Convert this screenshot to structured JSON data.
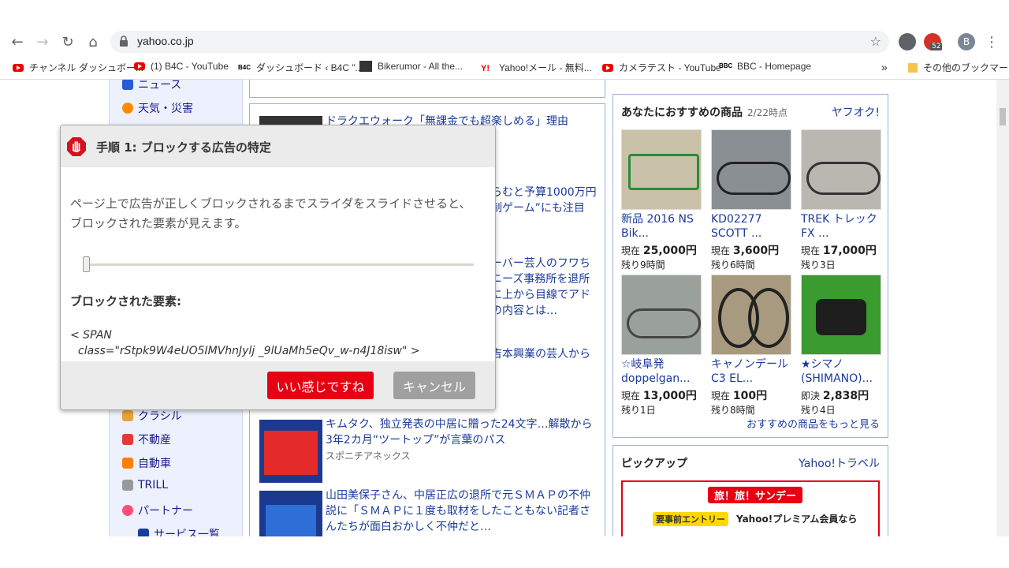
{
  "browser": {
    "url": "yahoo.co.jp",
    "extension_badge": "52",
    "profile_initial": "B",
    "bookmarks": [
      {
        "label": "チャンネル ダッシュボー...",
        "icon": "youtube-icon"
      },
      {
        "label": "(1) B4C - YouTube",
        "icon": "youtube-icon"
      },
      {
        "label": "ダッシュボード ‹ B4C ”...",
        "icon": "b4c-icon"
      },
      {
        "label": "Bikerumor - All the...",
        "icon": "bike-icon"
      },
      {
        "label": "Yahoo!メール - 無料...",
        "icon": "yahoo-icon"
      },
      {
        "label": "カメラテスト - YouTube",
        "icon": "youtube-icon"
      },
      {
        "label": "BBC - Homepage",
        "icon": "bbc-icon"
      }
    ],
    "bookmarks_more": "»",
    "other_bookmarks": "その他のブックマーク"
  },
  "left_nav": {
    "items": [
      {
        "label": "ニュース",
        "color": "#2a5bd7"
      },
      {
        "label": "天気・災害",
        "color": "#ff8a00"
      },
      {
        "label": "クラシル",
        "color": "#e8a23a"
      },
      {
        "label": "不動産",
        "color": "#e53935"
      },
      {
        "label": "自動車",
        "color": "#ff7f00"
      },
      {
        "label": "TRILL",
        "color": "#999999"
      },
      {
        "label": "パートナー",
        "color": "#ff4d7a"
      },
      {
        "label": "サービス一覧",
        "color": "#1a3a9c"
      }
    ]
  },
  "news": {
    "items": [
      {
        "title": "ドラクエウォーク「無課金でも超楽しめる」理由",
        "source": ""
      },
      {
        "title": "キムタク、独立発表の中居に贈った24文字…解散から3年2カ月“ツートップ”が言葉のパス",
        "source": "スポニチアネックス"
      },
      {
        "title": "山田美保子さん、中居正広の退所で元ＳＭＡＰの不仲説に「ＳＭＡＰに１度も取材をしたこともない記者さんたちが面白おかしく不仲だと…",
        "source": ""
      }
    ],
    "partial_lines": [
      "らむと予算1000万円",
      "制ゲーム”にも注目",
      "ーバー芸人のフワち",
      "ニーズ事務所を退所",
      "に上から目線でアド",
      "の内容とは…",
      "吉本興業の芸人から"
    ]
  },
  "recommend": {
    "title": "あなたにおすすめの商品",
    "time": "2/22時点",
    "link": "ヤフオク!",
    "more": "おすすめの商品をもっと見る",
    "products": [
      {
        "name": "新品 2016 NS Bik...",
        "price_label": "現在",
        "price": "25,000円",
        "left": "残り9時間"
      },
      {
        "name": "KD02277 SCOTT ...",
        "price_label": "現在",
        "price": "3,600円",
        "left": "残り6時間"
      },
      {
        "name": "TREK トレック　FX ...",
        "price_label": "現在",
        "price": "17,000円",
        "left": "残り3日"
      },
      {
        "name": "☆岐阜発 doppelgan...",
        "price_label": "現在",
        "price": "13,000円",
        "left": "残り1日"
      },
      {
        "name": "キャノンデール C3 EL...",
        "price_label": "現在",
        "price": "100円",
        "left": "残り8時間"
      },
      {
        "name": "★シマノ(SHIMANO)...",
        "price_label": "即決",
        "price": "2,838円",
        "left": "残り4日"
      }
    ]
  },
  "pickup": {
    "title": "ピックアップ",
    "link": "Yahoo!トラベル",
    "banner_top": "旅！旅！サンデー",
    "banner_entry": "要事前エントリー",
    "banner_text": "Yahoo!プレミアム会員なら"
  },
  "dialog": {
    "title": "手順 1: ブロックする広告の特定",
    "description": "ページ上で広告が正しくブロックされるまでスライダをスライドさせると、ブロックされた要素が見えます。",
    "slider_value": 0,
    "blocked_label": "ブロックされた要素:",
    "blocked_code_line1": "< SPAN",
    "blocked_code_line2": "class=\"rStpk9W4eUO5IMVhnJylj _9lUaMh5eQv_w-n4J18isw\" >",
    "ok_label": "いい感じですね",
    "cancel_label": "キャンセル",
    "ok_color": "#e60012",
    "cancel_color": "#a0a0a0"
  }
}
